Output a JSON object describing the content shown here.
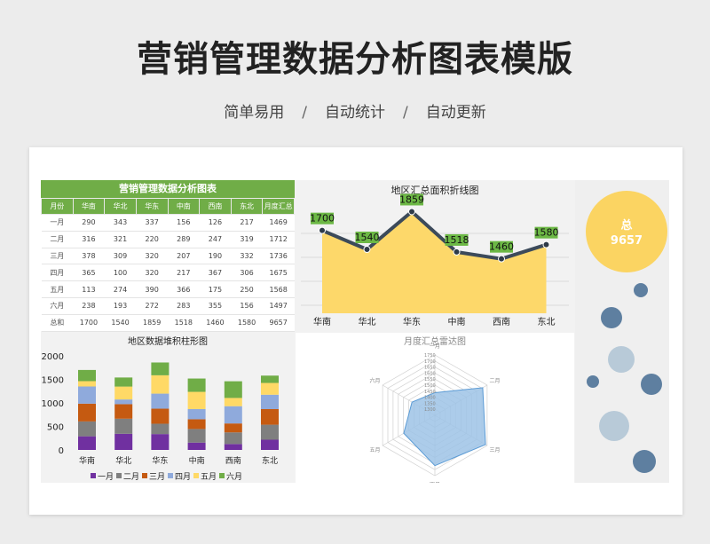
{
  "header": {
    "title": "营销管理数据分析图表模版",
    "tags": [
      "简单易用",
      "自动统计",
      "自动更新"
    ],
    "separator": "/"
  },
  "table": {
    "title": "营销管理数据分析图表",
    "headers": [
      "月份",
      "华南",
      "华北",
      "华东",
      "中南",
      "西南",
      "东北",
      "月度汇总"
    ],
    "rows": [
      [
        "一月",
        "290",
        "343",
        "337",
        "156",
        "126",
        "217",
        "1469"
      ],
      [
        "二月",
        "316",
        "321",
        "220",
        "289",
        "247",
        "319",
        "1712"
      ],
      [
        "三月",
        "378",
        "309",
        "320",
        "207",
        "190",
        "332",
        "1736"
      ],
      [
        "四月",
        "365",
        "100",
        "320",
        "217",
        "367",
        "306",
        "1675"
      ],
      [
        "五月",
        "113",
        "274",
        "390",
        "366",
        "175",
        "250",
        "1568"
      ],
      [
        "六月",
        "238",
        "193",
        "272",
        "283",
        "355",
        "156",
        "1497"
      ],
      [
        "总和",
        "1700",
        "1540",
        "1859",
        "1518",
        "1460",
        "1580",
        "9657"
      ]
    ]
  },
  "summary": {
    "label": "总",
    "value": "9657",
    "color": "#fbd462"
  },
  "chart_data": [
    {
      "type": "area",
      "title": "地区汇总面积折线图",
      "categories": [
        "华南",
        "华北",
        "华东",
        "中南",
        "西南",
        "东北"
      ],
      "values": [
        1700,
        1540,
        1859,
        1518,
        1460,
        1580
      ],
      "ylim": [
        1000,
        1900
      ],
      "grid": true,
      "colors": {
        "fill": "#fdd86a",
        "line": "#3c4a5a",
        "label_bg": "#6cb845"
      }
    },
    {
      "type": "bar",
      "stacked": true,
      "title": "地区数据堆积柱形图",
      "categories": [
        "华南",
        "华北",
        "华东",
        "中南",
        "西南",
        "东北"
      ],
      "yticks": [
        "2000",
        "1500",
        "1000",
        "500",
        "0"
      ],
      "ylim": [
        0,
        2000
      ],
      "legend_position": "bottom",
      "series": [
        {
          "name": "一月",
          "values": [
            290,
            343,
            337,
            156,
            126,
            217
          ],
          "color": "#7030a0"
        },
        {
          "name": "二月",
          "values": [
            316,
            321,
            220,
            289,
            247,
            319
          ],
          "color": "#7f7f7f"
        },
        {
          "name": "三月",
          "values": [
            378,
            309,
            320,
            207,
            190,
            332
          ],
          "color": "#c55a11"
        },
        {
          "name": "四月",
          "values": [
            365,
            100,
            320,
            217,
            367,
            306
          ],
          "color": "#8faadc"
        },
        {
          "name": "五月",
          "values": [
            113,
            274,
            390,
            366,
            175,
            250
          ],
          "color": "#ffd966"
        },
        {
          "name": "六月",
          "values": [
            238,
            193,
            272,
            283,
            355,
            156
          ],
          "color": "#70ad47"
        }
      ]
    },
    {
      "type": "radar",
      "title": "月度汇总雷达图",
      "categories": [
        "一月",
        "二月",
        "三月",
        "四月",
        "五月",
        "六月"
      ],
      "values": [
        1469,
        1712,
        1736,
        1675,
        1568,
        1497
      ],
      "rticks": [
        "1750",
        "1700",
        "1650",
        "1600",
        "1550",
        "1500",
        "1450",
        "1400",
        "1350",
        "1300"
      ],
      "rlim": [
        1300,
        1750
      ],
      "colors": {
        "fill": "#9dc3e6",
        "line": "#5b9bd5"
      }
    }
  ],
  "bubbles": [
    {
      "cx": 722,
      "cy": 327,
      "r": 8,
      "color": "#5e7fa0"
    },
    {
      "cx": 689,
      "cy": 358,
      "r": 12,
      "color": "#5e7fa0"
    },
    {
      "cx": 700,
      "cy": 405,
      "r": 15,
      "color": "#b8cad8"
    },
    {
      "cx": 668,
      "cy": 430,
      "r": 7,
      "color": "#5e7fa0"
    },
    {
      "cx": 734,
      "cy": 433,
      "r": 12,
      "color": "#5e7fa0"
    },
    {
      "cx": 692,
      "cy": 480,
      "r": 17,
      "color": "#b8cad8"
    },
    {
      "cx": 726,
      "cy": 520,
      "r": 13,
      "color": "#5e7fa0"
    }
  ]
}
